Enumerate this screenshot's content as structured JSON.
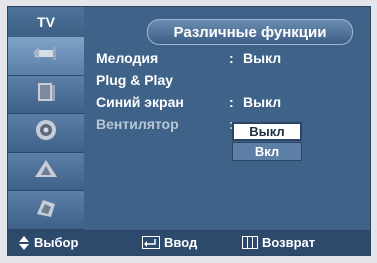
{
  "header": {
    "tv_label": "TV",
    "title": "Различные функции"
  },
  "sidebar": {
    "items": [
      {
        "icon": "antenna-icon"
      },
      {
        "icon": "tv-picture-icon"
      },
      {
        "icon": "speaker-icon"
      },
      {
        "icon": "channel-icon"
      },
      {
        "icon": "setup-icon"
      }
    ],
    "active_index": 0
  },
  "menu": {
    "rows": [
      {
        "label": "Мелодия",
        "colon": ":",
        "value": "Выкл"
      },
      {
        "label": "Plug & Play",
        "colon": "",
        "value": ""
      },
      {
        "label": "Синий экран",
        "colon": ":",
        "value": "Выкл"
      },
      {
        "label": "Вентилятор",
        "colon": ":",
        "value": ""
      }
    ],
    "dropdown": {
      "selected": "Выкл",
      "other": "Вкл"
    }
  },
  "footer": {
    "select": "Выбор",
    "enter": "Ввод",
    "return": "Возврат"
  },
  "colors": {
    "panel": "#3f6388",
    "footer": "#2d4a6c",
    "background": "#e3e5ea"
  }
}
